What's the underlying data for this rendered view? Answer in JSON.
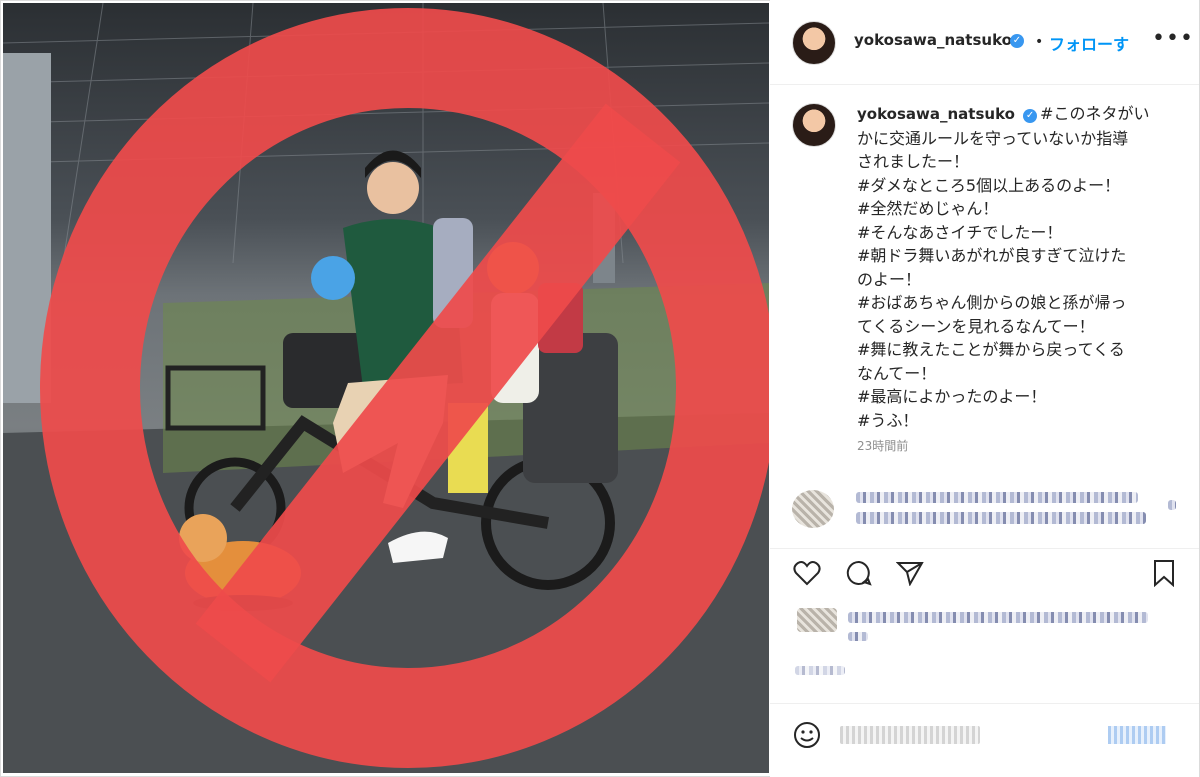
{
  "post": {
    "username": "yokosawa_natsuko",
    "follow_label": "フォローす",
    "separator": "•",
    "more_label": "•••",
    "caption_lines": [
      "#このネタがい",
      "かに交通ルールを守っていないか指導",
      "されましたー！",
      "#ダメなところ5個以上あるのよー！",
      "#全然だめじゃん！",
      "#そんなあさイチでしたー！",
      "#朝ドラ舞いあがれが良すぎて泣けた",
      "のよー！",
      "#おばあちゃん側からの娘と孫が帰っ",
      "てくるシーンを見れるなんてー！",
      "#舞に教えたことが舞から戻ってくる",
      "なんてー！",
      "#最高によかったのよー！",
      "#うふ！"
    ],
    "timestamp": "23時間前"
  },
  "icons": {
    "verified": "verified-badge-icon",
    "like": "heart-icon",
    "comment": "comment-icon",
    "share": "share-icon",
    "save": "bookmark-icon",
    "emoji": "emoji-icon"
  },
  "colors": {
    "accent": "#0095f6",
    "verified": "#3897f0",
    "prohibition": "#ef4b4b"
  }
}
